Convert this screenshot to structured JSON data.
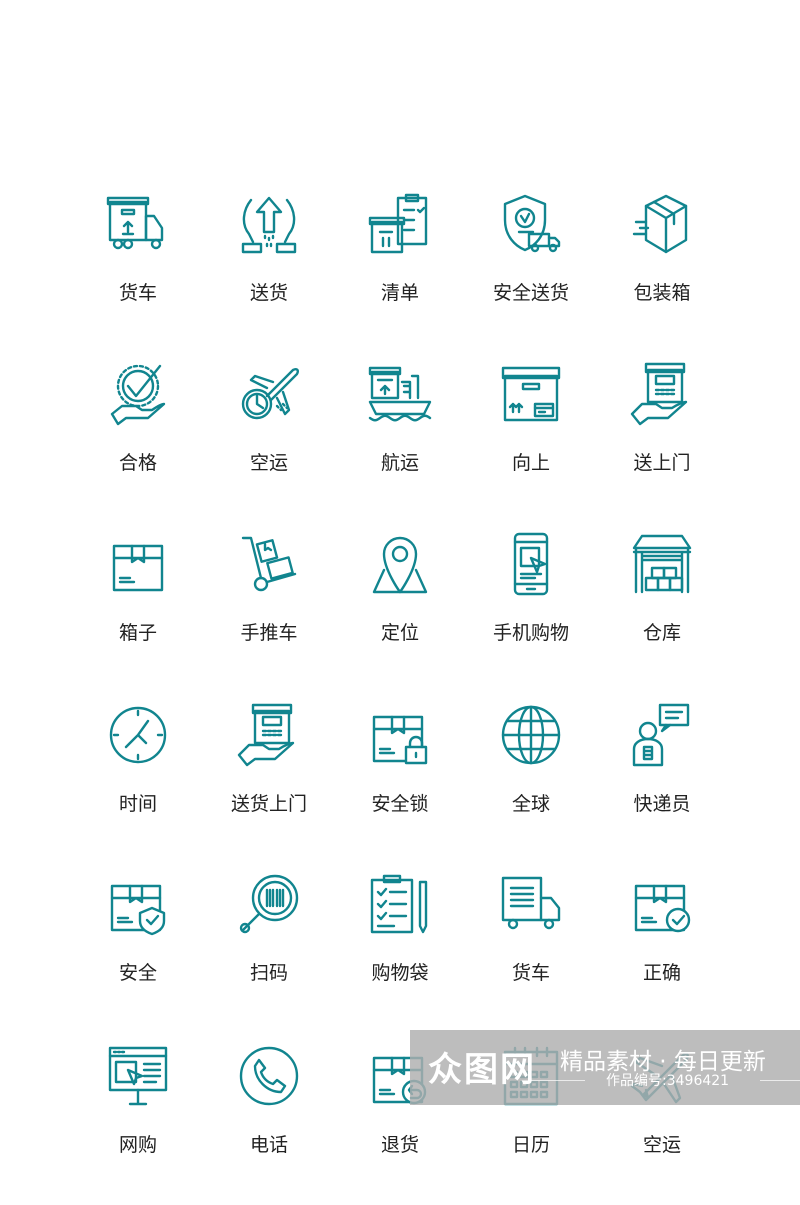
{
  "accent_color": "#11858f",
  "icons": [
    {
      "label": "货车",
      "icon": "truck-box-icon"
    },
    {
      "label": "送货",
      "icon": "hands-arrow-icon"
    },
    {
      "label": "清单",
      "icon": "box-clipboard-icon"
    },
    {
      "label": "安全送货",
      "icon": "shield-truck-icon"
    },
    {
      "label": "包装箱",
      "icon": "package-icon"
    },
    {
      "label": "合格",
      "icon": "hand-check-icon"
    },
    {
      "label": "空运",
      "icon": "plane-clock-icon"
    },
    {
      "label": "航运",
      "icon": "ship-icon"
    },
    {
      "label": "向上",
      "icon": "box-up-icon"
    },
    {
      "label": "送上门",
      "icon": "hand-box-icon"
    },
    {
      "label": "箱子",
      "icon": "box-icon"
    },
    {
      "label": "手推车",
      "icon": "hand-truck-icon"
    },
    {
      "label": "定位",
      "icon": "map-pin-icon"
    },
    {
      "label": "手机购物",
      "icon": "phone-cursor-icon"
    },
    {
      "label": "仓库",
      "icon": "warehouse-icon"
    },
    {
      "label": "时间",
      "icon": "clock-icon"
    },
    {
      "label": "送货上门",
      "icon": "hand-box-icon"
    },
    {
      "label": "安全锁",
      "icon": "box-lock-icon"
    },
    {
      "label": "全球",
      "icon": "globe-icon"
    },
    {
      "label": "快递员",
      "icon": "courier-icon"
    },
    {
      "label": "安全",
      "icon": "box-shield-icon"
    },
    {
      "label": "扫码",
      "icon": "magnifier-barcode-icon"
    },
    {
      "label": "购物袋",
      "icon": "checklist-icon"
    },
    {
      "label": "货车",
      "icon": "truck-icon"
    },
    {
      "label": "正确",
      "icon": "box-check-icon"
    },
    {
      "label": "网购",
      "icon": "monitor-cursor-icon"
    },
    {
      "label": "电话",
      "icon": "phone-icon"
    },
    {
      "label": "退货",
      "icon": "box-return-icon"
    },
    {
      "label": "日历",
      "icon": "calendar-icon"
    },
    {
      "label": "空运",
      "icon": "plane-icon"
    }
  ],
  "watermark": {
    "logo": "众图网",
    "slogan": "精品素材 · 每日更新",
    "work_id": "作品编号:3496421"
  }
}
